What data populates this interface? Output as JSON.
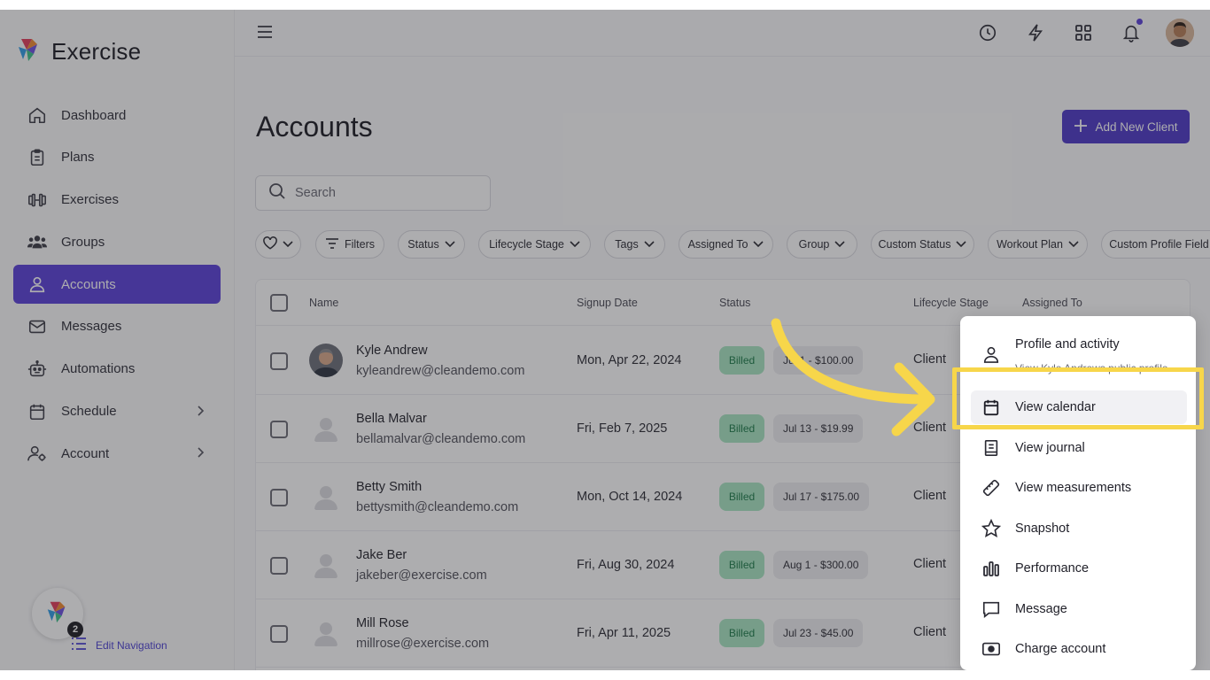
{
  "brand": {
    "name": "Exercise"
  },
  "sidebar": {
    "items": [
      {
        "label": "Dashboard",
        "icon": "home-icon"
      },
      {
        "label": "Plans",
        "icon": "clipboard-icon"
      },
      {
        "label": "Exercises",
        "icon": "dumbbell-icon"
      },
      {
        "label": "Groups",
        "icon": "users-icon"
      },
      {
        "label": "Accounts",
        "icon": "user-icon",
        "active": true
      },
      {
        "label": "Messages",
        "icon": "mail-icon"
      },
      {
        "label": "Automations",
        "icon": "robot-icon"
      },
      {
        "label": "Schedule",
        "icon": "calendar-icon",
        "expandable": true
      },
      {
        "label": "Account",
        "icon": "user-settings-icon",
        "expandable": true
      }
    ],
    "edit_navigation": {
      "label": "Edit Navigation",
      "badge": "2"
    }
  },
  "topbar": {
    "icons": [
      "history-icon",
      "lightning-icon",
      "apps-grid-icon",
      "bell-icon",
      "profile-avatar"
    ]
  },
  "page": {
    "title": "Accounts",
    "add_button_label": "Add New Client",
    "search_placeholder": "Search"
  },
  "filters": [
    {
      "label": "",
      "icon": "heart-icon"
    },
    {
      "label": "Filters",
      "icon": "filter-icon"
    },
    {
      "label": "Status"
    },
    {
      "label": "Lifecycle Stage"
    },
    {
      "label": "Tags"
    },
    {
      "label": "Assigned To"
    },
    {
      "label": "Group"
    },
    {
      "label": "Custom Status"
    },
    {
      "label": "Workout Plan"
    },
    {
      "label": "Custom Profile Field"
    }
  ],
  "table": {
    "columns": [
      "Name",
      "Signup Date",
      "Status",
      "Lifecycle Stage",
      "Assigned To"
    ],
    "rows": [
      {
        "name": "Kyle Andrew",
        "email": "kyleandrew@cleandemo.com",
        "signup": "Mon, Apr 22, 2024",
        "status": "Billed",
        "plan": "Jul 1 - $100.00",
        "stage": "Client",
        "photo": true
      },
      {
        "name": "Bella Malvar",
        "email": "bellamalvar@cleandemo.com",
        "signup": "Fri, Feb 7, 2025",
        "status": "Billed",
        "plan": "Jul 13 - $19.99",
        "stage": "Client"
      },
      {
        "name": "Betty Smith",
        "email": "bettysmith@cleandemo.com",
        "signup": "Mon, Oct 14, 2024",
        "status": "Billed",
        "plan": "Jul 17 - $175.00",
        "stage": "Client"
      },
      {
        "name": "Jake Ber",
        "email": "jakeber@exercise.com",
        "signup": "Fri, Aug 30, 2024",
        "status": "Billed",
        "plan": "Aug 1 - $300.00",
        "stage": "Client"
      },
      {
        "name": "Mill Rose",
        "email": "millrose@exercise.com",
        "signup": "Fri, Apr 11, 2025",
        "status": "Billed",
        "plan": "Jul 23 - $45.00",
        "stage": "Client"
      }
    ]
  },
  "menu": {
    "profile": {
      "label": "Profile and activity",
      "sub": "View Kyle Andrews public profile"
    },
    "items": [
      {
        "label": "View calendar",
        "icon": "calendar-icon",
        "highlighted": true
      },
      {
        "label": "View journal",
        "icon": "journal-icon"
      },
      {
        "label": "View measurements",
        "icon": "ruler-icon"
      },
      {
        "label": "Snapshot",
        "icon": "star-icon"
      },
      {
        "label": "Performance",
        "icon": "bar-chart-icon"
      },
      {
        "label": "Message",
        "icon": "message-icon"
      },
      {
        "label": "Charge account",
        "icon": "money-icon"
      }
    ]
  },
  "colors": {
    "accent": "#5a3fd8",
    "billed_bg": "#a8e6c2",
    "highlight": "#f7d64a"
  }
}
